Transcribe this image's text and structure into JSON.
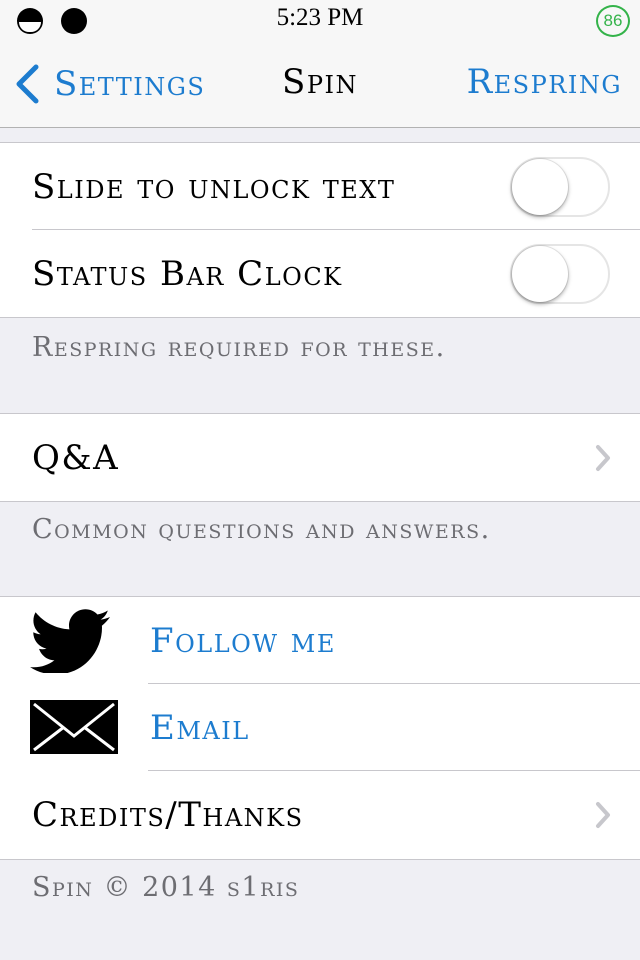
{
  "status_bar": {
    "time": "5:23 PM",
    "battery": "86"
  },
  "nav": {
    "back_label": "Settings",
    "title": "Spin",
    "right_button": "Respring"
  },
  "toggles": [
    {
      "label": "Slide to unlock text",
      "on": false
    },
    {
      "label": "Status Bar Clock",
      "on": false
    }
  ],
  "toggles_footer": "Respring required for these.",
  "qa": {
    "label": "Q&A",
    "footer": "Common questions and answers."
  },
  "links": {
    "twitter_label": "Follow me",
    "email_label": "Email",
    "credits_label": "Credits/Thanks"
  },
  "footer": "Spin © 2014 s1ris",
  "colors": {
    "accent": "#1d7ccf",
    "background": "#efeff4",
    "battery": "#34b34a"
  },
  "icons": [
    "chevron-left-icon",
    "chevron-right-icon",
    "twitter-bird-icon",
    "envelope-icon"
  ]
}
